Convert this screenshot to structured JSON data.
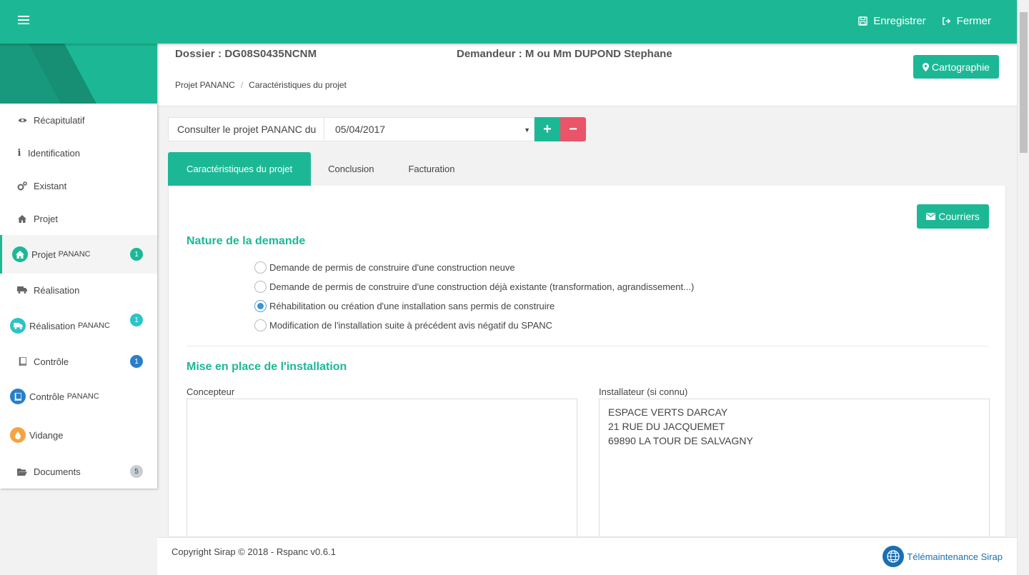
{
  "topbar": {
    "save_label": "Enregistrer",
    "close_label": "Fermer"
  },
  "sidebar": {
    "items": [
      {
        "label": "Récapitulatif",
        "icon": "eye-icon"
      },
      {
        "label": "Identification",
        "icon": "info-icon"
      },
      {
        "label": "Existant",
        "icon": "gears-icon"
      },
      {
        "label": "Projet",
        "icon": "home-icon"
      },
      {
        "label": "Projet",
        "label_small": "PANANC",
        "icon": "home-icon",
        "badge": "1",
        "active": true
      },
      {
        "label": "Réalisation",
        "icon": "truck-icon"
      },
      {
        "label": "Réalisation",
        "label_small": "PANANC",
        "icon": "truck-icon",
        "badge": "1"
      },
      {
        "label": "Contrôle",
        "icon": "book-icon",
        "badge": "1"
      },
      {
        "label": "Contrôle",
        "label_small": "PANANC",
        "icon": "book-icon"
      },
      {
        "label": "Vidange",
        "icon": "drop-icon"
      },
      {
        "label": "Documents",
        "icon": "folder-open-icon",
        "badge": "5"
      }
    ]
  },
  "colors": {
    "accent": "#1cb896",
    "danger": "#ea5468",
    "info": "#2cc3c9",
    "blue": "#2a7fc6",
    "orange": "#f5a343"
  },
  "header": {
    "dossier": "Dossier : DG08S0435NCNM",
    "demandeur": "Demandeur : M ou Mm DUPOND  Stephane",
    "breadcrumb": [
      "Projet PANANC",
      "Caractéristiques du projet"
    ],
    "carto_label": "Cartographie"
  },
  "consult": {
    "label": "Consulter le projet PANANC du",
    "selected_date": "05/04/2017",
    "add_symbol": "+",
    "remove_symbol": "−"
  },
  "tabs": [
    {
      "label": "Caractéristiques du projet",
      "active": true
    },
    {
      "label": "Conclusion"
    },
    {
      "label": "Facturation"
    }
  ],
  "card": {
    "courriers_label": "Courriers",
    "nature_title": "Nature de la demande",
    "nature_options": [
      {
        "label": "Demande de permis de construire d'une construction neuve",
        "checked": false
      },
      {
        "label": "Demande de permis de construire d'une construction déjà existante (transformation, agrandissement...)",
        "checked": false
      },
      {
        "label": "Réhabilitation ou création d'une installation sans permis de construire",
        "checked": true
      },
      {
        "label": "Modification de l'installation suite à précédent avis négatif du SPANC",
        "checked": false
      }
    ],
    "installation_title": "Mise en place de l'installation",
    "concepteur_label": "Concepteur",
    "concepteur_value": "",
    "installateur_label": "Installateur (si connu)",
    "installateur_value": "ESPACE VERTS DARCAY\n21 RUE DU JACQUEMET\n69890 LA TOUR DE SALVAGNY"
  },
  "footer": {
    "copyright": "Copyright Sirap © 2018 - Rspanc v0.6.1",
    "support": "Télémaintenance Sirap"
  }
}
